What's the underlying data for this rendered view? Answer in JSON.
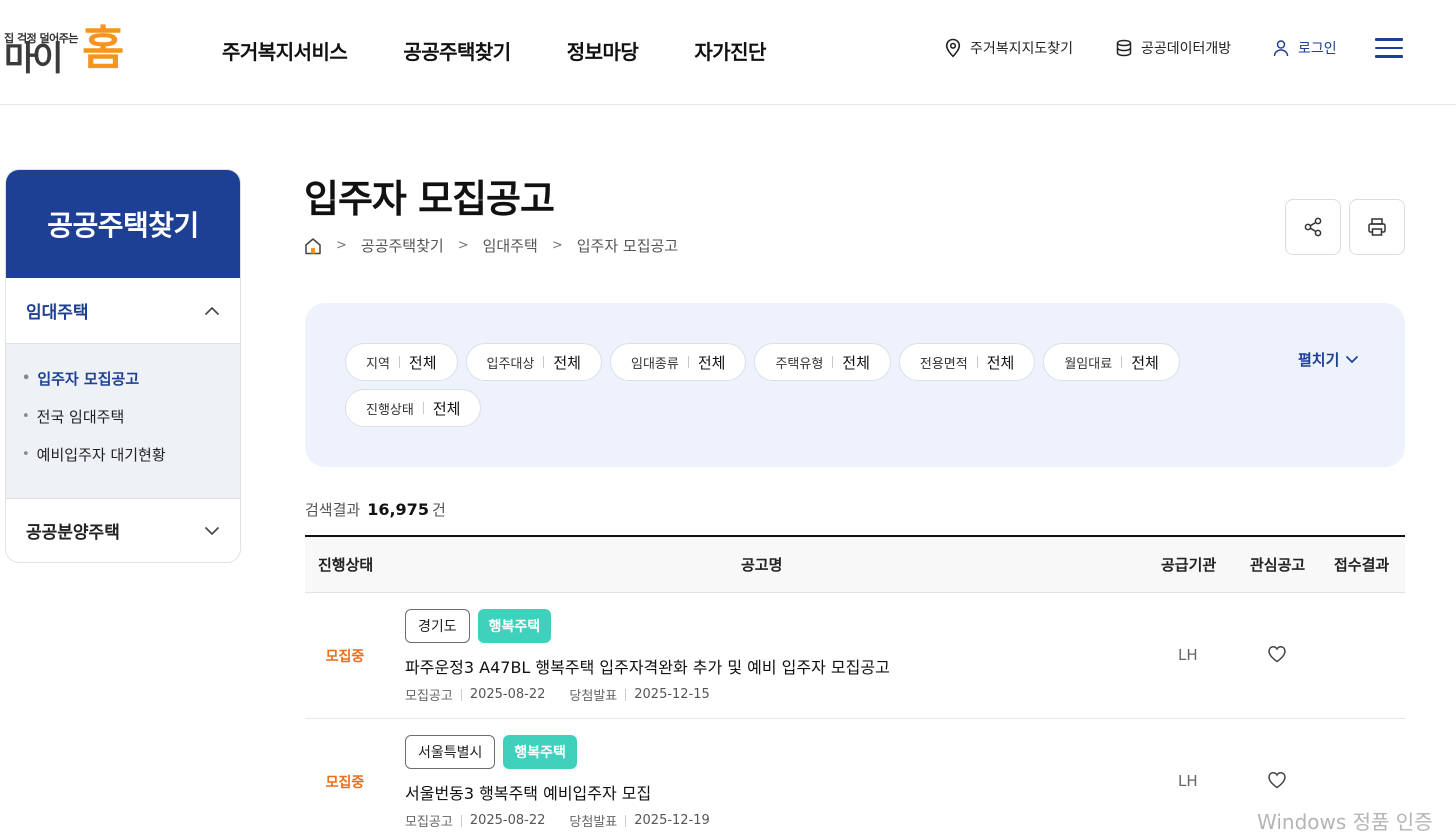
{
  "logo": {
    "tagline": "집 걱정 덜어주는",
    "name_part1": "마이",
    "name_part2": "홈"
  },
  "gnb": [
    "주거복지서비스",
    "공공주택찾기",
    "정보마당",
    "자가진단"
  ],
  "util": {
    "map": "주거복지지도찾기",
    "data": "공공데이터개방",
    "login": "로그인"
  },
  "sidebar": {
    "title": "공공주택찾기",
    "menu1": "임대주택",
    "sub": [
      "입주자 모집공고",
      "전국 임대주택",
      "예비입주자 대기현황"
    ],
    "menu2": "공공분양주택"
  },
  "page": {
    "title": "입주자 모집공고",
    "breadcrumb": [
      "공공주택찾기",
      "임대주택",
      "입주자 모집공고"
    ]
  },
  "filters": [
    {
      "label": "지역",
      "value": "전체"
    },
    {
      "label": "입주대상",
      "value": "전체"
    },
    {
      "label": "임대종류",
      "value": "전체"
    },
    {
      "label": "주택유형",
      "value": "전체"
    },
    {
      "label": "전용면적",
      "value": "전체"
    },
    {
      "label": "월임대료",
      "value": "전체"
    },
    {
      "label": "진행상태",
      "value": "전체"
    }
  ],
  "expand_label": "펼치기",
  "result": {
    "label": "검색결과",
    "count": "16,975",
    "unit": "건"
  },
  "table": {
    "headers": [
      "진행상태",
      "공고명",
      "공급기관",
      "관심공고",
      "접수결과"
    ],
    "rows": [
      {
        "status": "모집중",
        "region": "경기도",
        "type": "행복주택",
        "title": "파주운정3 A47BL 행복주택 입주자격완화 추가 및 예비 입주자 모집공고",
        "notice_label": "모집공고",
        "notice_date": "2025-08-22",
        "result_label": "당첨발표",
        "result_date": "2025-12-15",
        "org": "LH"
      },
      {
        "status": "모집중",
        "region": "서울특별시",
        "type": "행복주택",
        "title": "서울번동3 행복주택 예비입주자 모집",
        "notice_label": "모집공고",
        "notice_date": "2025-08-22",
        "result_label": "당첨발표",
        "result_date": "2025-12-19",
        "org": "LH"
      }
    ]
  },
  "watermark": "Windows 정품 인증",
  "colors": {
    "brand_blue": "#1d3f94",
    "logo_orange": "#f7941d",
    "status_orange": "#f06d17",
    "tag_teal": "#3fd1bc",
    "filter_bg": "#edf2fd"
  }
}
